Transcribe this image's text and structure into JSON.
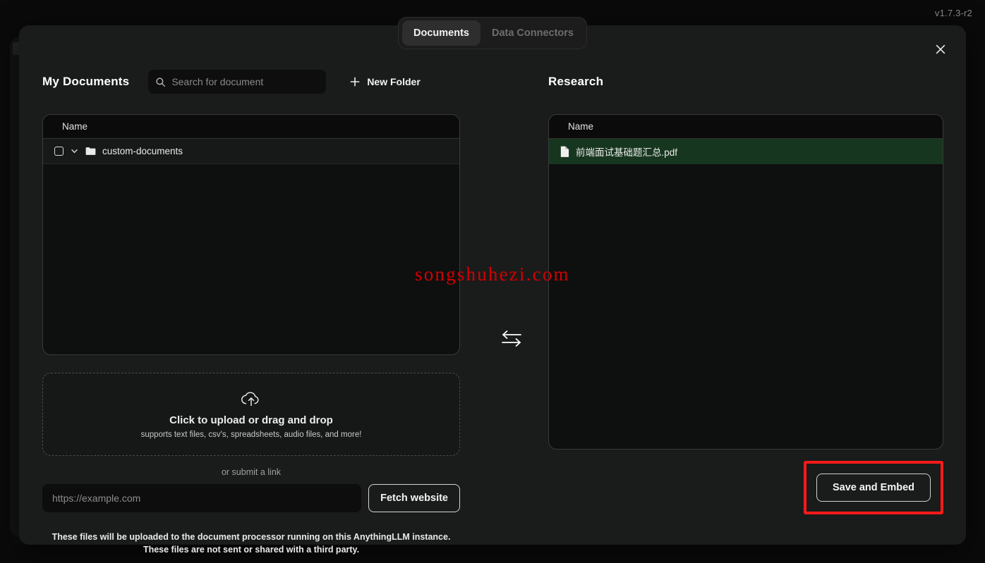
{
  "app": {
    "version_label": "v1.7.3-r2"
  },
  "tabs": [
    {
      "label": "Documents",
      "active": true
    },
    {
      "label": "Data Connectors",
      "active": false
    }
  ],
  "modal": {
    "close_icon": "close-icon"
  },
  "left_panel": {
    "title": "My Documents",
    "search": {
      "placeholder": "Search for document",
      "value": "",
      "icon": "search-icon"
    },
    "new_folder": {
      "label": "New Folder",
      "icon": "plus-icon"
    },
    "table": {
      "column_header": "Name",
      "rows": [
        {
          "name": "custom-documents",
          "type": "folder",
          "checkbox_checked": false,
          "expanded": false,
          "icons": [
            "checkbox-icon",
            "chevron-down-icon",
            "folder-icon"
          ]
        }
      ]
    },
    "dropzone": {
      "icon": "cloud-upload-icon",
      "title": "Click to upload or drag and drop",
      "subtitle": "supports text files, csv's, spreadsheets, audio files, and more!"
    },
    "or_link_label": "or submit a link",
    "url_input": {
      "placeholder": "https://example.com",
      "value": ""
    },
    "fetch_button_label": "Fetch website",
    "disclaimer_line1": "These files will be uploaded to the document processor running on this AnythingLLM instance.",
    "disclaimer_line2": "These files are not sent or shared with a third party."
  },
  "transfer": {
    "icon": "transfer-arrows-icon"
  },
  "right_panel": {
    "title": "Research",
    "table": {
      "column_header": "Name",
      "rows": [
        {
          "name": "前端面试基础题汇总.pdf",
          "type": "file",
          "selected": true,
          "icon": "document-icon"
        }
      ]
    },
    "save_button_label": "Save and Embed",
    "annotation_color": "#ff1a1a"
  },
  "watermark": {
    "text": "songshuhezi.com",
    "color": "#d20000"
  },
  "colors": {
    "modal_bg": "#1a1b1b",
    "panel_bg": "#0e0f0f",
    "selected_row_green": "#17361f",
    "accent_red": "#ff1a1a"
  }
}
